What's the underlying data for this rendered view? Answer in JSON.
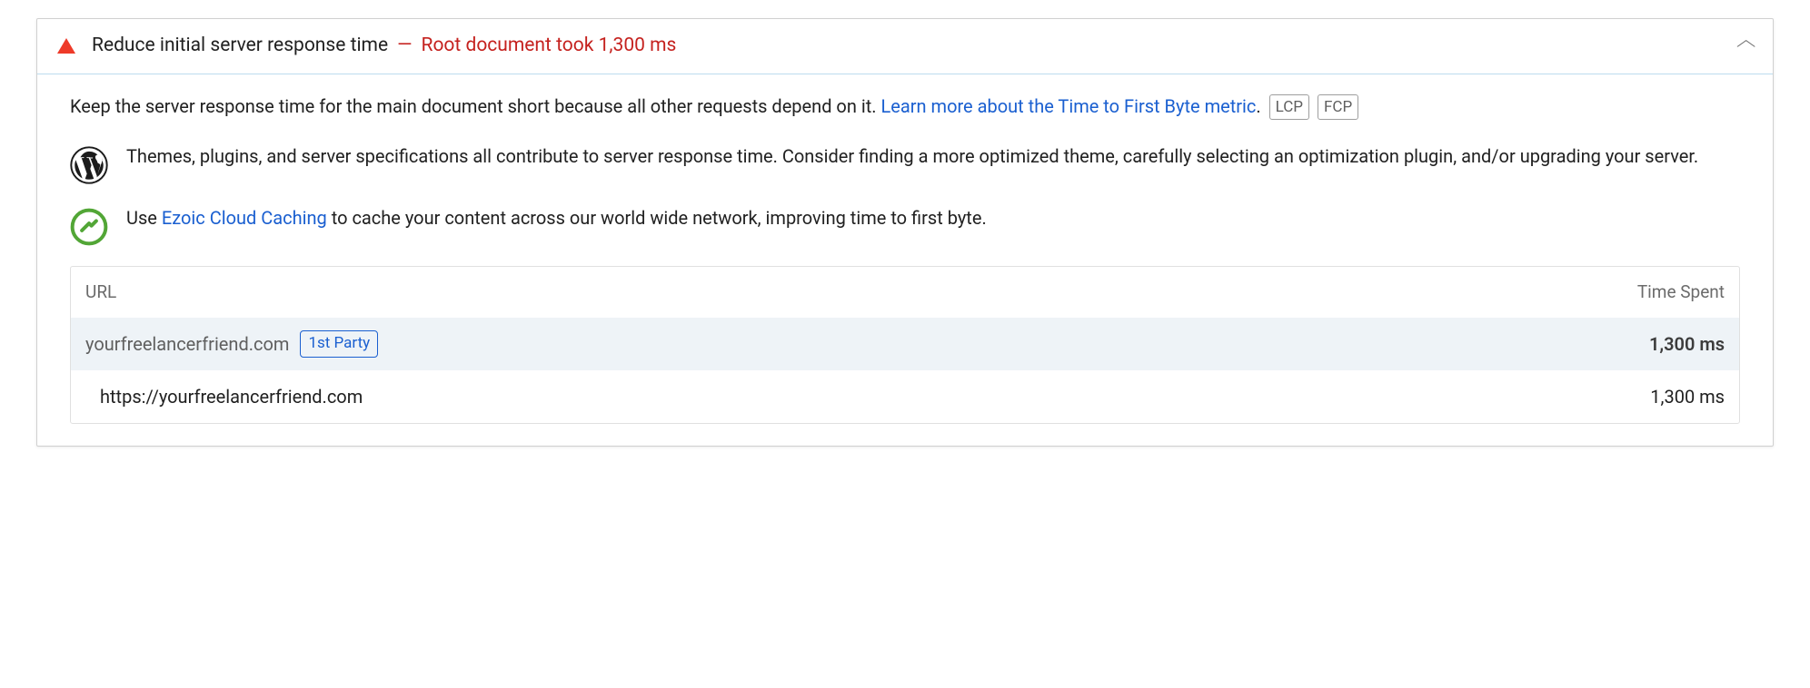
{
  "audit": {
    "title": "Reduce initial server response time",
    "separator": "—",
    "displayValue": "Root document took 1,300 ms"
  },
  "description": {
    "intro": "Keep the server response time for the main document short because all other requests depend on it. ",
    "linkText": "Learn more about the Time to First Byte metric",
    "suffix": "."
  },
  "metricBadges": [
    "LCP",
    "FCP"
  ],
  "stackPacks": [
    {
      "icon": "wordpress",
      "text": "Themes, plugins, and server specifications all contribute to server response time. Consider finding a more optimized theme, carefully selecting an optimization plugin, and/or upgrading your server."
    },
    {
      "icon": "ezoic",
      "prefix": "Use ",
      "linkText": "Ezoic Cloud Caching",
      "suffix": " to cache your content across our world wide network, improving time to first byte."
    }
  ],
  "table": {
    "headers": {
      "url": "URL",
      "time": "Time Spent"
    },
    "group": {
      "domain": "yourfreelancerfriend.com",
      "party": "1st Party",
      "time": "1,300 ms"
    },
    "rows": [
      {
        "url": "https://yourfreelancerfriend.com",
        "time": "1,300 ms"
      }
    ]
  }
}
